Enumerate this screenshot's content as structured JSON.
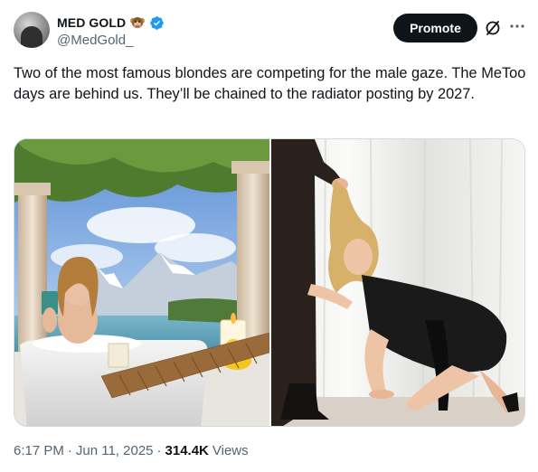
{
  "author": {
    "display_name": "MED GOLD",
    "handle": "@MedGold_",
    "badge_icon": "monkey-icon",
    "verified_icon": "verified-badge-icon",
    "verified_color": "#1d9bf0"
  },
  "actions": {
    "promote_label": "Promote",
    "grok_icon": "grok-icon",
    "more_icon": "more-icon"
  },
  "tweet": {
    "text": "Two of the most famous blondes are competing for the male gaze. The MeToo days are behind us. They’ll be chained to the radiator posting by 2027."
  },
  "media": {
    "photos": [
      {
        "name": "photo-bathtub"
      },
      {
        "name": "photo-kneeling"
      }
    ]
  },
  "meta": {
    "time": "6:17 PM",
    "sep1": "·",
    "date": "Jun 11, 2025",
    "sep2": "·",
    "views_count": "314.4K",
    "views_label": "Views"
  },
  "colors": {
    "text": "#0f1419",
    "secondary": "#536471",
    "accent": "#1d9bf0",
    "button_bg": "#0f1419"
  }
}
